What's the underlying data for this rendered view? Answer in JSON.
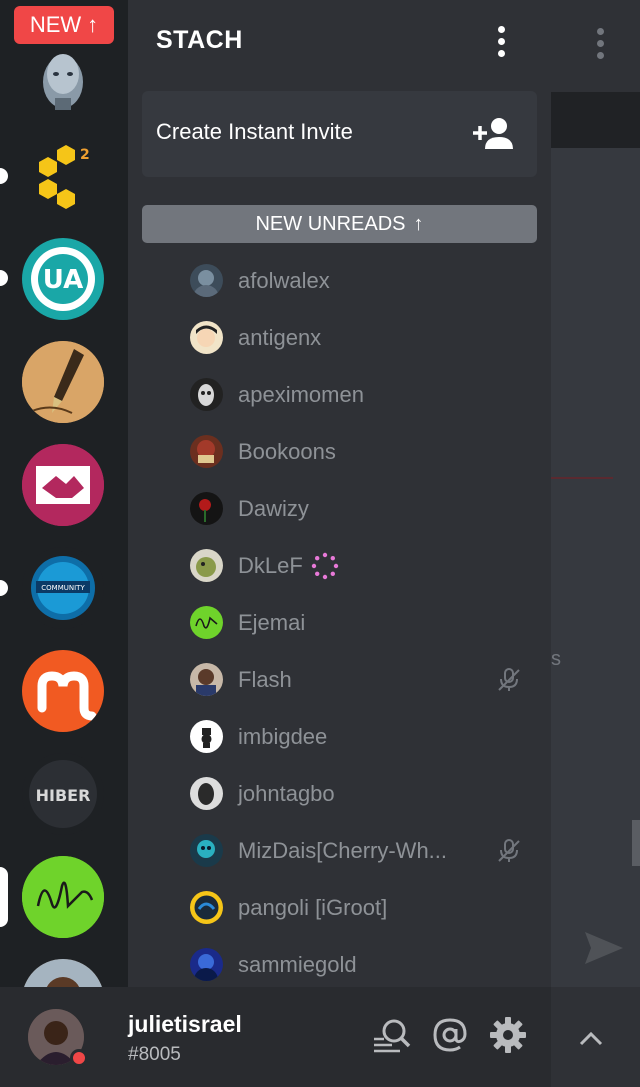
{
  "new_badge": {
    "label": "NEW",
    "arrow": "↑"
  },
  "guild": {
    "name": "STACH"
  },
  "invite": {
    "label": "Create Instant Invite"
  },
  "unreads": {
    "label": "NEW UNREADS",
    "arrow": "↑"
  },
  "members": [
    {
      "name": "afolwalex"
    },
    {
      "name": "antigenx"
    },
    {
      "name": "apeximomen"
    },
    {
      "name": "Bookoons"
    },
    {
      "name": "Dawizy"
    },
    {
      "name": "DkLeF"
    },
    {
      "name": "Ejemai"
    },
    {
      "name": "Flash"
    },
    {
      "name": "imbigdee"
    },
    {
      "name": "johntagbo"
    },
    {
      "name": "MizDais[Cherry-Wh..."
    },
    {
      "name": "pangoli [iGroot]"
    },
    {
      "name": "sammiegold"
    }
  ],
  "user": {
    "name": "julietisrael",
    "tag": "#8005"
  },
  "peek": {
    "fragment": "s"
  },
  "colors": {
    "accent_red": "#f04747",
    "panel": "#2f3136",
    "rail": "#1e2124",
    "footer": "#292b2f"
  }
}
